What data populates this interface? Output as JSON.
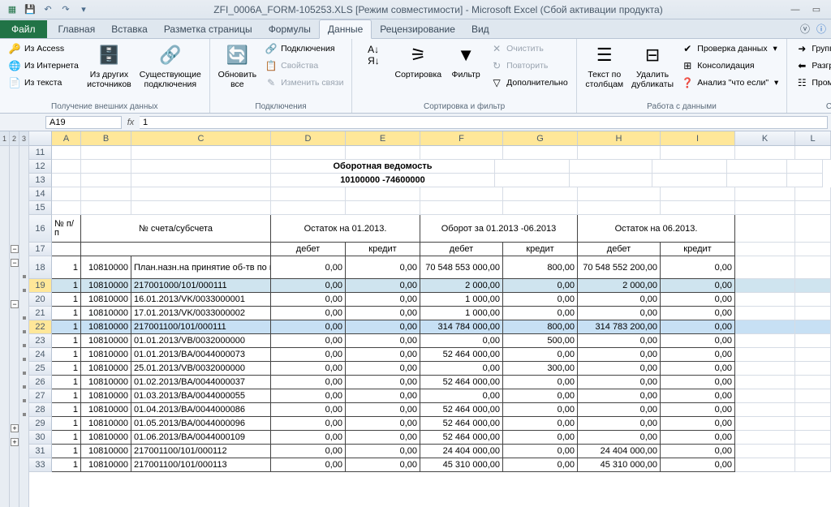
{
  "title": "ZFI_0006A_FORM-105253.XLS  [Режим совместимости]  -  Microsoft Excel (Сбой активации продукта)",
  "tabs": {
    "file": "Файл",
    "items": [
      "Главная",
      "Вставка",
      "Разметка страницы",
      "Формулы",
      "Данные",
      "Рецензирование",
      "Вид"
    ],
    "active": 4
  },
  "ribbon": {
    "ext_data": {
      "access": "Из Access",
      "web": "Из Интернета",
      "text": "Из текста",
      "other": "Из других\nисточников",
      "existing": "Существующие\nподключения",
      "label": "Получение внешних данных"
    },
    "conn": {
      "refresh": "Обновить\nвсе",
      "links": "Подключения",
      "props": "Свойства",
      "edit": "Изменить связи",
      "label": "Подключения"
    },
    "sort": {
      "sort": "Сортировка",
      "filter": "Фильтр",
      "clear": "Очистить",
      "reapply": "Повторить",
      "adv": "Дополнительно",
      "label": "Сортировка и фильтр"
    },
    "tools": {
      "t2c": "Текст по\nстолбцам",
      "dup": "Удалить\nдубликаты",
      "valid": "Проверка данных",
      "consol": "Консолидация",
      "whatif": "Анализ \"что если\"",
      "label": "Работа с данными"
    },
    "outline": {
      "group": "Группировать",
      "ungroup": "Разгруппировать",
      "subtotal": "Промежуточный итог",
      "label": "Структура"
    }
  },
  "formula_bar": {
    "name": "A19",
    "value": "1"
  },
  "columns": [
    "A",
    "B",
    "C",
    "D",
    "E",
    "F",
    "G",
    "H",
    "I",
    "K",
    "L"
  ],
  "outline_headers": [
    "1",
    "2",
    "3"
  ],
  "report": {
    "title": "Оборотная ведомость",
    "subtitle": "10100000 -74600000",
    "hdr_acct": "№ счета/субсчета",
    "hdr_no": "№\nп/п",
    "hdr_ost1": "Остаток на 01.2013.",
    "hdr_obor": "Оборот за  01.2013 -06.2013",
    "hdr_ost2": "Остаток на 06.2013.",
    "debit": "дебет",
    "credit": "кредит"
  },
  "rows": [
    {
      "r": 11
    },
    {
      "r": 12,
      "title": true
    },
    {
      "r": 13,
      "subtitle": true
    },
    {
      "r": 14
    },
    {
      "r": 15
    },
    {
      "r": 16,
      "hdr1": true
    },
    {
      "r": 17,
      "hdr2": true
    },
    {
      "r": 18,
      "a": "1",
      "b": "10810000",
      "c": "План.назн.на принятие об-тв по индив.плану финан.",
      "d": "0,00",
      "e": "0,00",
      "f": "70 548 553 000,00",
      "g": "800,00",
      "h": "70 548 552 200,00",
      "i": "0,00"
    },
    {
      "r": 19,
      "hl": true,
      "active": true,
      "a": "1",
      "b": "10810000",
      "c": "217001000/101/000111",
      "d": "0,00",
      "e": "0,00",
      "f": "2 000,00",
      "g": "0,00",
      "h": "2 000,00",
      "i": "0,00"
    },
    {
      "r": 20,
      "a": "1",
      "b": "10810000",
      "c": "16.01.2013/VK/0033000001",
      "d": "0,00",
      "e": "0,00",
      "f": "1 000,00",
      "g": "0,00",
      "h": "0,00",
      "i": "0,00"
    },
    {
      "r": 21,
      "a": "1",
      "b": "10810000",
      "c": "17.01.2013/VK/0033000002",
      "d": "0,00",
      "e": "0,00",
      "f": "1 000,00",
      "g": "0,00",
      "h": "0,00",
      "i": "0,00"
    },
    {
      "r": 22,
      "hl": true,
      "a": "1",
      "b": "10810000",
      "c": "217001100/101/000111",
      "d": "0,00",
      "e": "0,00",
      "f": "314 784 000,00",
      "g": "800,00",
      "h": "314 783 200,00",
      "i": "0,00"
    },
    {
      "r": 23,
      "a": "1",
      "b": "10810000",
      "c": "01.01.2013/VB/0032000000",
      "d": "0,00",
      "e": "0,00",
      "f": "0,00",
      "g": "500,00",
      "h": "0,00",
      "i": "0,00"
    },
    {
      "r": 24,
      "a": "1",
      "b": "10810000",
      "c": "01.01.2013/BA/0044000073",
      "d": "0,00",
      "e": "0,00",
      "f": "52 464 000,00",
      "g": "0,00",
      "h": "0,00",
      "i": "0,00"
    },
    {
      "r": 25,
      "a": "1",
      "b": "10810000",
      "c": "25.01.2013/VB/0032000000",
      "d": "0,00",
      "e": "0,00",
      "f": "0,00",
      "g": "300,00",
      "h": "0,00",
      "i": "0,00"
    },
    {
      "r": 26,
      "a": "1",
      "b": "10810000",
      "c": "01.02.2013/BA/0044000037",
      "d": "0,00",
      "e": "0,00",
      "f": "52 464 000,00",
      "g": "0,00",
      "h": "0,00",
      "i": "0,00"
    },
    {
      "r": 27,
      "a": "1",
      "b": "10810000",
      "c": "01.03.2013/BA/0044000055",
      "d": "0,00",
      "e": "0,00",
      "f": "0,00",
      "g": "0,00",
      "h": "0,00",
      "i": "0,00"
    },
    {
      "r": 28,
      "a": "1",
      "b": "10810000",
      "c": "01.04.2013/BA/0044000086",
      "d": "0,00",
      "e": "0,00",
      "f": "52 464 000,00",
      "g": "0,00",
      "h": "0,00",
      "i": "0,00"
    },
    {
      "r": 29,
      "a": "1",
      "b": "10810000",
      "c": "01.05.2013/BA/0044000096",
      "d": "0,00",
      "e": "0,00",
      "f": "52 464 000,00",
      "g": "0,00",
      "h": "0,00",
      "i": "0,00"
    },
    {
      "r": 30,
      "a": "1",
      "b": "10810000",
      "c": "01.06.2013/BA/0044000109",
      "d": "0,00",
      "e": "0,00",
      "f": "52 464 000,00",
      "g": "0,00",
      "h": "0,00",
      "i": "0,00"
    },
    {
      "r": 31,
      "a": "1",
      "b": "10810000",
      "c": "217001100/101/000112",
      "d": "0,00",
      "e": "0,00",
      "f": "24 404 000,00",
      "g": "0,00",
      "h": "24 404 000,00",
      "i": "0,00"
    },
    {
      "r": 33,
      "a": "1",
      "b": "10810000",
      "c": "217001100/101/000113",
      "d": "0,00",
      "e": "0,00",
      "f": "45 310 000,00",
      "g": "0,00",
      "h": "45 310 000,00",
      "i": "0,00"
    }
  ],
  "outline_marks": {
    "col2": {
      "minus": [
        19,
        22
      ],
      "plus": [
        31,
        33
      ]
    },
    "col3": {
      "dots": [
        20,
        21,
        23,
        24,
        25,
        26,
        27,
        28,
        29,
        30
      ]
    }
  }
}
